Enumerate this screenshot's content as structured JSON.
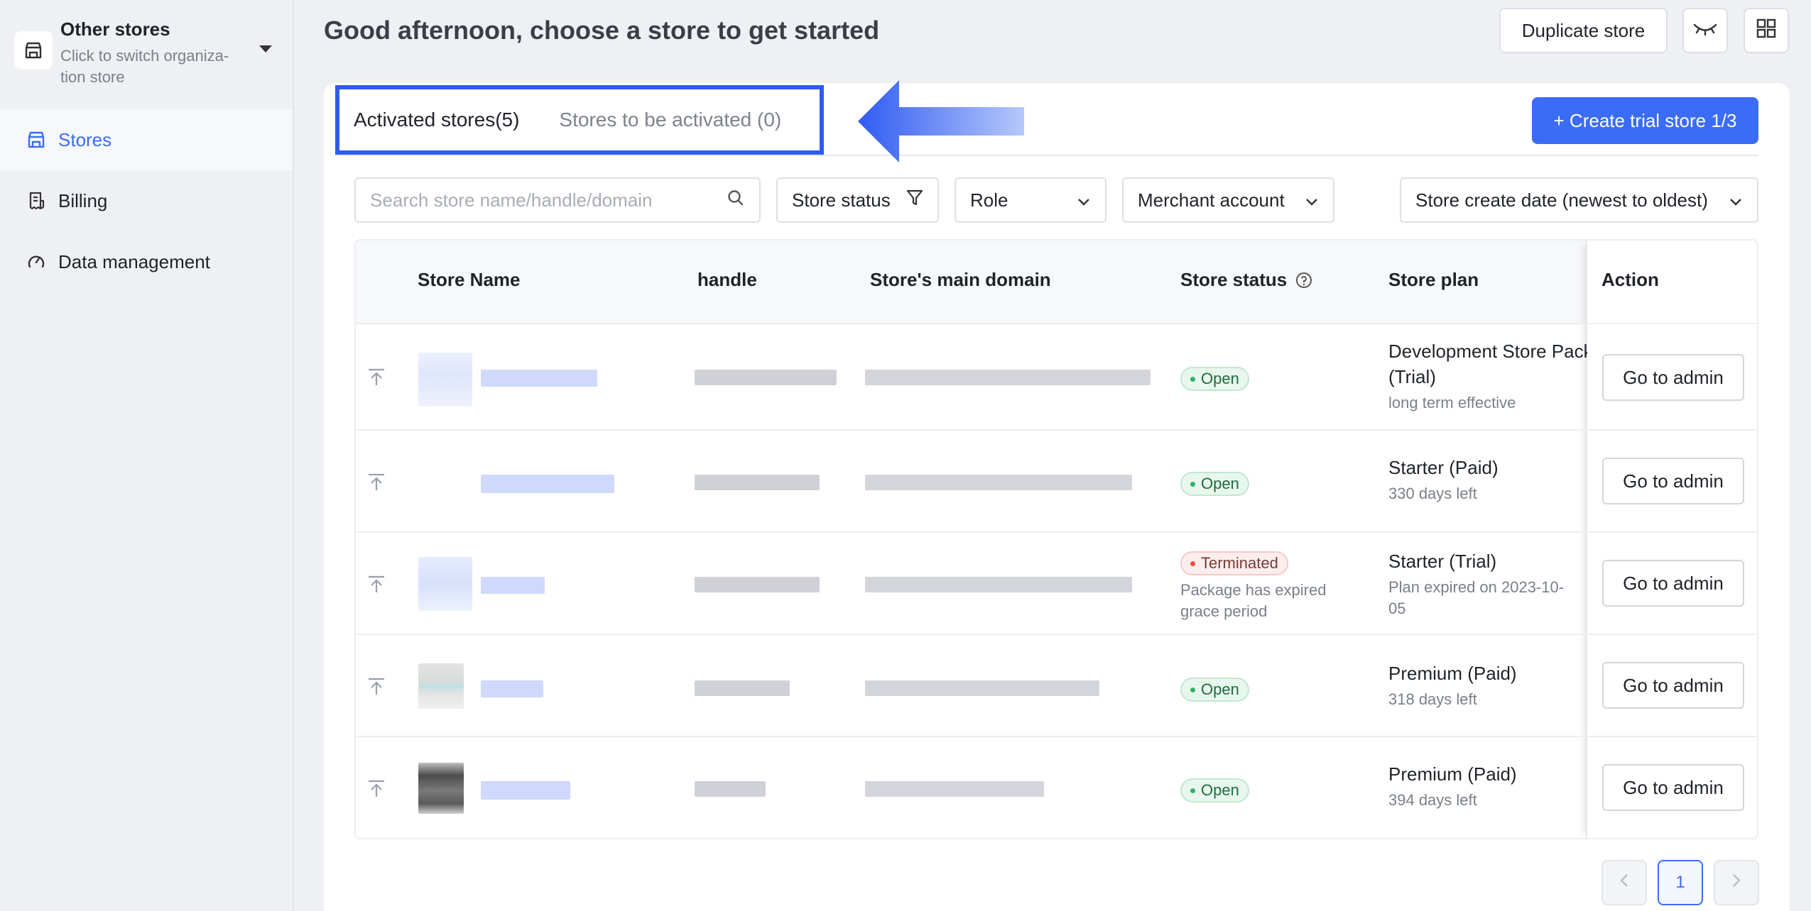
{
  "sidebar": {
    "org_title": "Other stores",
    "org_subtitle": "Click to switch organiza-tion store",
    "items": [
      {
        "label": "Stores",
        "active": true
      },
      {
        "label": "Billing",
        "active": false
      },
      {
        "label": "Data management",
        "active": false
      }
    ]
  },
  "header": {
    "greeting": "Good afternoon, choose a store to get started",
    "duplicate_label": "Duplicate store"
  },
  "tabs": {
    "activated": "Activated stores(5)",
    "to_activate": "Stores to be activated (0)",
    "create_trial": "+ Create trial store 1/3"
  },
  "filters": {
    "search_placeholder": "Search store name/handle/domain",
    "status": "Store status",
    "role": "Role",
    "merchant": "Merchant account",
    "sort": "Store create date (newest to oldest)"
  },
  "table": {
    "columns": {
      "name": "Store Name",
      "handle": "handle",
      "domain": "Store's main domain",
      "status": "Store status",
      "plan": "Store plan",
      "action": "Action"
    },
    "action_label": "Go to admin",
    "rows": [
      {
        "status": "Open",
        "status_note": "",
        "plan": "Development Store Pack",
        "plan_line2": "(Trial)",
        "plan_note": "long term effective"
      },
      {
        "status": "Open",
        "status_note": "",
        "plan": "Starter (Paid)",
        "plan_line2": "",
        "plan_note": "330 days left"
      },
      {
        "status": "Terminated",
        "status_note": "Package has expired grace period",
        "plan": "Starter (Trial)",
        "plan_line2": "",
        "plan_note": "Plan expired on 2023-10-05"
      },
      {
        "status": "Open",
        "status_note": "",
        "plan": "Premium (Paid)",
        "plan_line2": "",
        "plan_note": "318 days left"
      },
      {
        "status": "Open",
        "status_note": "",
        "plan": "Premium (Paid)",
        "plan_line2": "",
        "plan_note": "394 days left"
      }
    ]
  },
  "pagination": {
    "current": "1"
  },
  "colors": {
    "accent": "#3b6cf6",
    "highlight_border": "#2f5bf3",
    "open": "#2fb463",
    "terminated": "#e6533f"
  }
}
